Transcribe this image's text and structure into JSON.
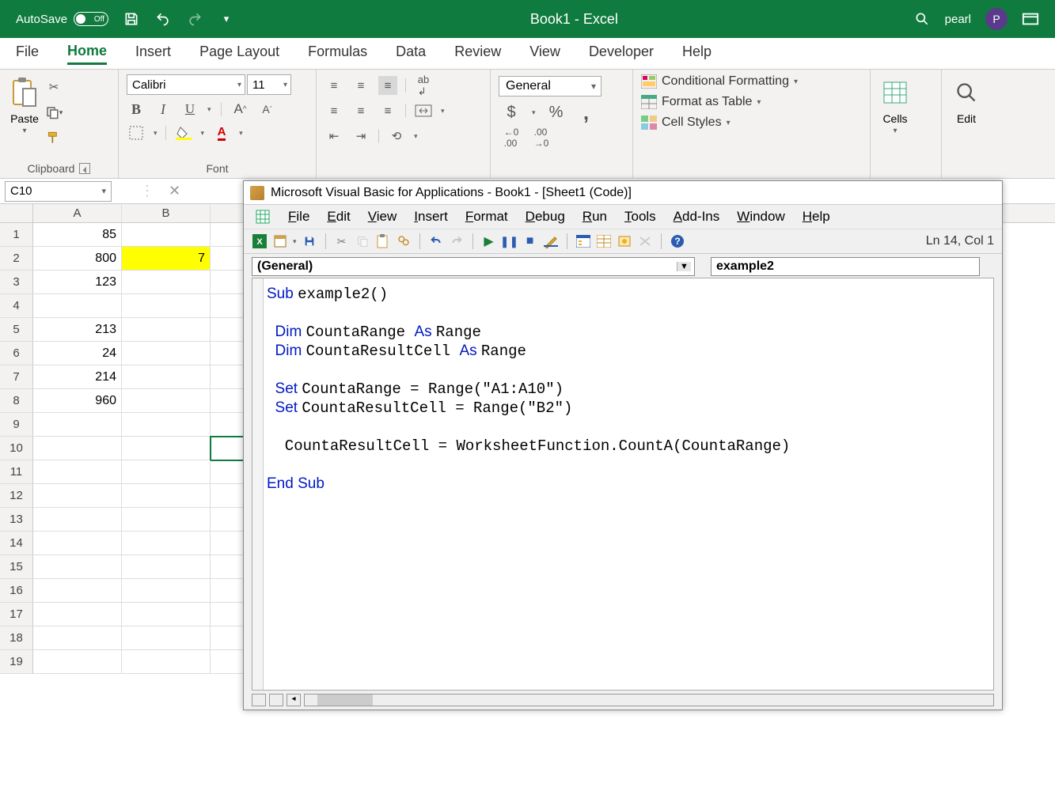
{
  "title_bar": {
    "autosave_label": "AutoSave",
    "autosave_state": "Off",
    "doc_title": "Book1 - Excel",
    "username": "pearl",
    "user_initial": "P"
  },
  "ribbon_tabs": [
    "File",
    "Home",
    "Insert",
    "Page Layout",
    "Formulas",
    "Data",
    "Review",
    "View",
    "Developer",
    "Help"
  ],
  "active_tab": "Home",
  "clipboard_group": {
    "paste": "Paste",
    "label": "Clipboard"
  },
  "font_group": {
    "label": "Font",
    "font_name": "Calibri",
    "font_size": "11"
  },
  "number_group": {
    "format": "General"
  },
  "styles_group": {
    "conditional": "Conditional Formatting",
    "table": "Format as Table",
    "cell": "Cell Styles"
  },
  "cells_group": {
    "label": "Cells"
  },
  "editing_group": {
    "label": "Edit"
  },
  "name_box": "C10",
  "columns": [
    "A",
    "B"
  ],
  "rows": [
    {
      "n": 1,
      "A": "85",
      "B": ""
    },
    {
      "n": 2,
      "A": "800",
      "B": "7",
      "B_hl": true
    },
    {
      "n": 3,
      "A": "123",
      "B": ""
    },
    {
      "n": 4,
      "A": "",
      "B": ""
    },
    {
      "n": 5,
      "A": "213",
      "B": ""
    },
    {
      "n": 6,
      "A": "24",
      "B": ""
    },
    {
      "n": 7,
      "A": "214",
      "B": ""
    },
    {
      "n": 8,
      "A": "960",
      "B": ""
    },
    {
      "n": 9,
      "A": "",
      "B": ""
    },
    {
      "n": 10,
      "A": "",
      "B": ""
    },
    {
      "n": 11,
      "A": "",
      "B": ""
    },
    {
      "n": 12,
      "A": "",
      "B": ""
    },
    {
      "n": 13,
      "A": "",
      "B": ""
    },
    {
      "n": 14,
      "A": "",
      "B": ""
    },
    {
      "n": 15,
      "A": "",
      "B": ""
    },
    {
      "n": 16,
      "A": "",
      "B": ""
    },
    {
      "n": 17,
      "A": "",
      "B": ""
    },
    {
      "n": 18,
      "A": "",
      "B": ""
    },
    {
      "n": 19,
      "A": "",
      "B": ""
    }
  ],
  "vbe": {
    "title": "Microsoft Visual Basic for Applications - Book1 - [Sheet1 (Code)]",
    "menus": [
      "File",
      "Edit",
      "View",
      "Insert",
      "Format",
      "Debug",
      "Run",
      "Tools",
      "Add-Ins",
      "Window",
      "Help"
    ],
    "status": "Ln 14, Col 1",
    "object_combo": "(General)",
    "proc_combo": "example2",
    "code_lines": [
      {
        "t": "Sub ",
        "k": true
      },
      {
        "t": "example2()\n"
      },
      {
        "t": "\n"
      },
      {
        "t": "  Dim ",
        "k": true
      },
      {
        "t": "CountaRange "
      },
      {
        "t": "As ",
        "k": true
      },
      {
        "t": "Range\n"
      },
      {
        "t": "  Dim ",
        "k": true
      },
      {
        "t": "CountaResultCell "
      },
      {
        "t": "As ",
        "k": true
      },
      {
        "t": "Range\n"
      },
      {
        "t": "\n"
      },
      {
        "t": "  Set ",
        "k": true
      },
      {
        "t": "CountaRange = Range(\"A1:A10\")\n"
      },
      {
        "t": "  Set ",
        "k": true
      },
      {
        "t": "CountaResultCell = Range(\"B2\")\n"
      },
      {
        "t": "\n"
      },
      {
        "t": "  CountaResultCell = WorksheetFunction.CountA(CountaRange)\n"
      },
      {
        "t": "\n"
      },
      {
        "t": "End Sub",
        "k": true
      }
    ]
  }
}
